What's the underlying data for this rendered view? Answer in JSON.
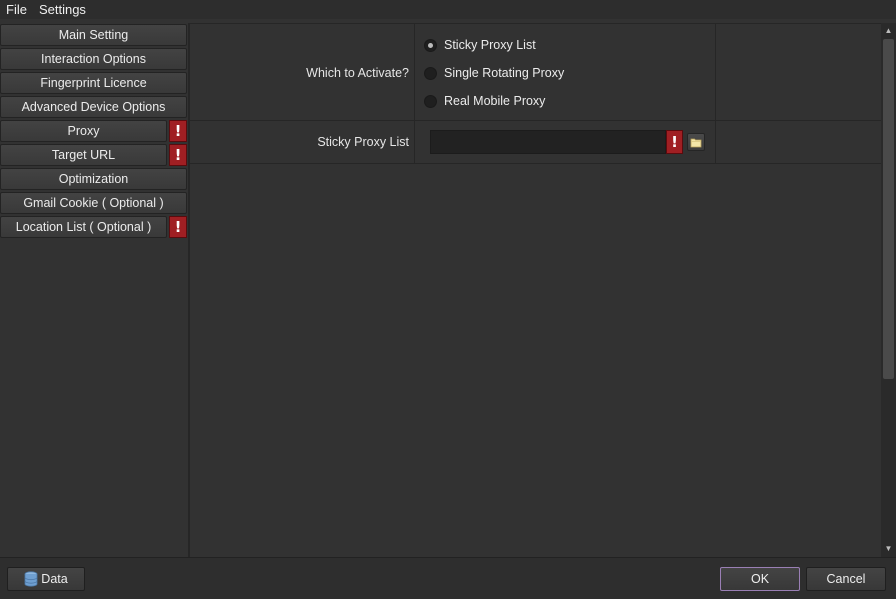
{
  "menubar": {
    "items": [
      "File",
      "Settings"
    ]
  },
  "sidebar": {
    "items": [
      {
        "label": "Main Setting",
        "warning": false
      },
      {
        "label": "Interaction Options",
        "warning": false
      },
      {
        "label": "Fingerprint Licence",
        "warning": false
      },
      {
        "label": "Advanced Device Options",
        "warning": false
      },
      {
        "label": "Proxy",
        "warning": true
      },
      {
        "label": "Target URL",
        "warning": true
      },
      {
        "label": "Optimization",
        "warning": false
      },
      {
        "label": "Gmail Cookie ( Optional )",
        "warning": false
      },
      {
        "label": "Location List ( Optional )",
        "warning": true
      }
    ],
    "warning_glyph": "!"
  },
  "main": {
    "activate_label": "Which to Activate?",
    "radio_options": [
      {
        "label": "Sticky Proxy List",
        "checked": true
      },
      {
        "label": "Single Rotating Proxy",
        "checked": false
      },
      {
        "label": "Real Mobile Proxy",
        "checked": false
      }
    ],
    "sticky_label": "Sticky Proxy List",
    "sticky_value": "",
    "warning_glyph": "!",
    "folder_icon": "folder-icon"
  },
  "bottom": {
    "data_button": "Data",
    "ok_button": "OK",
    "cancel_button": "Cancel"
  },
  "colors": {
    "background": "#323232",
    "warning": "#a01f23",
    "ok_border": "#9a7fb5"
  }
}
